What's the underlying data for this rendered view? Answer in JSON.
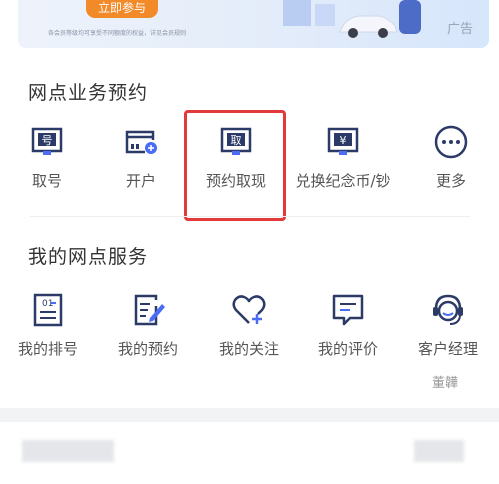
{
  "banner": {
    "button_label": "立即参与",
    "note": "各会员等级均可享受不同额度的权益，详见会员规则",
    "ad_label": "广告"
  },
  "branch_business": {
    "title": "网点业务预约",
    "items": [
      {
        "label": "取号",
        "icon": "ticket-number-icon",
        "glyph": "号"
      },
      {
        "label": "开户",
        "icon": "open-account-card-icon"
      },
      {
        "label": "预约取现",
        "icon": "withdraw-cash-icon",
        "glyph": "取"
      },
      {
        "label": "兑换纪念币/钞",
        "icon": "commemorative-coin-icon",
        "glyph": "¥"
      },
      {
        "label": "更多",
        "icon": "more-dots-icon"
      }
    ]
  },
  "my_services": {
    "title": "我的网点服务",
    "items": [
      {
        "label": "我的排号",
        "icon": "queue-number-icon",
        "glyph": "01"
      },
      {
        "label": "我的预约",
        "icon": "appointment-edit-icon"
      },
      {
        "label": "我的关注",
        "icon": "heart-plus-icon"
      },
      {
        "label": "我的评价",
        "icon": "review-chat-icon"
      },
      {
        "label": "客户经理",
        "icon": "customer-manager-icon"
      }
    ],
    "manager_name": "董韡"
  },
  "colors": {
    "icon_dark": "#2b3a67",
    "accent_blue": "#4a6cf7",
    "highlight_red": "#e23a3a",
    "banner_orange": "#f28a2a"
  }
}
